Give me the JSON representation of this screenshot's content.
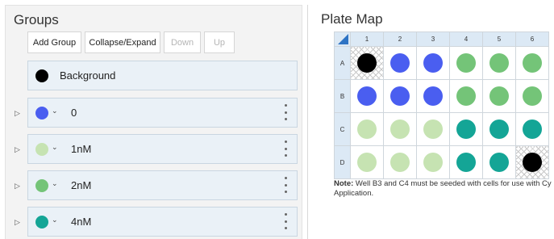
{
  "groups_panel": {
    "title": "Groups",
    "buttons": {
      "add_group": "Add Group",
      "collapse_expand": "Collapse/Expand",
      "down": "Down",
      "up": "Up"
    },
    "items": [
      {
        "label": "Background",
        "color": "#000000",
        "expandable": false
      },
      {
        "label": "0",
        "color": "#4a5ef0",
        "expandable": true
      },
      {
        "label": "1nM",
        "color": "#c6e3b2",
        "expandable": true
      },
      {
        "label": "2nM",
        "color": "#74c478",
        "expandable": true
      },
      {
        "label": "4nM",
        "color": "#14a596",
        "expandable": true
      }
    ]
  },
  "plate_map": {
    "title": "Plate Map",
    "columns": [
      "1",
      "2",
      "3",
      "4",
      "5",
      "6"
    ],
    "rows": [
      {
        "label": "A",
        "wells": [
          "background",
          "0",
          "0",
          "2nM",
          "2nM",
          "2nM"
        ]
      },
      {
        "label": "B",
        "wells": [
          "0",
          "0",
          "0",
          "2nM",
          "2nM",
          "2nM"
        ]
      },
      {
        "label": "C",
        "wells": [
          "1nM",
          "1nM",
          "1nM",
          "4nM",
          "4nM",
          "4nM"
        ]
      },
      {
        "label": "D",
        "wells": [
          "1nM",
          "1nM",
          "1nM",
          "4nM",
          "4nM",
          "background"
        ]
      }
    ],
    "group_colors": {
      "background": "#000000",
      "0": "#4a5ef0",
      "1nM": "#c6e3b2",
      "2nM": "#74c478",
      "4nM": "#14a596"
    },
    "note_label": "Note:",
    "note_text": " Well B3 and C4 must be seeded with cells for use with Cy",
    "note_text_line2": "Application."
  }
}
